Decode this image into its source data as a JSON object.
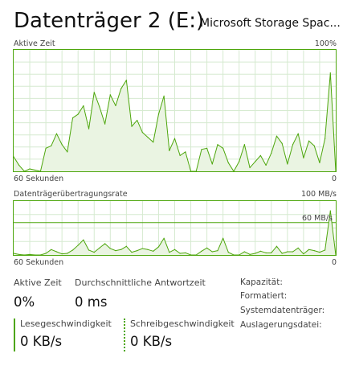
{
  "header": {
    "title": "Datenträger 2 (E:)",
    "model": "Microsoft Storage Spac..."
  },
  "active_time_graph": {
    "label": "Aktive Zeit",
    "max_label": "100%",
    "time_label": "60 Sekunden",
    "min_label": "0"
  },
  "transfer_graph": {
    "label": "Datenträgerübertragungsrate",
    "max_label": "100 MB/s",
    "ref_label": "60 MB/s",
    "time_label": "60 Sekunden",
    "min_label": "0"
  },
  "stats": {
    "active_time": {
      "label": "Aktive Zeit",
      "value": "0%"
    },
    "avg_response": {
      "label": "Durchschnittliche Antwortzeit",
      "value": "0 ms"
    },
    "read_speed": {
      "label": "Lesegeschwindigkeit",
      "value": "0 KB/s"
    },
    "write_speed": {
      "label": "Schreibgeschwindigkeit",
      "value": "0 KB/s"
    }
  },
  "properties": [
    {
      "label": "Kapazität:",
      "value": ""
    },
    {
      "label": "Formatiert:",
      "value": ""
    },
    {
      "label": "Systemdatenträger:",
      "value": ""
    },
    {
      "label": "Auslagerungsdatei:",
      "value": ""
    }
  ],
  "colors": {
    "line": "#4da60c",
    "fill": "#eaf4e2",
    "grid": "#d6ead0",
    "border": "#4da60c"
  },
  "chart_data": [
    {
      "type": "area",
      "ylabel": "Aktive Zeit",
      "x_unit": "seconds ago",
      "xlim": [
        60,
        0
      ],
      "ylim": [
        0,
        100
      ],
      "grid": true,
      "x": [
        60,
        59,
        58,
        57,
        56,
        55,
        54,
        53,
        52,
        51,
        50,
        49,
        48,
        47,
        46,
        45,
        44,
        43,
        42,
        41,
        40,
        39,
        38,
        37,
        36,
        35,
        34,
        33,
        32,
        31,
        30,
        29,
        28,
        27,
        26,
        25,
        24,
        23,
        22,
        21,
        20,
        19,
        18,
        17,
        16,
        15,
        14,
        13,
        12,
        11,
        10,
        9,
        8,
        7,
        6,
        5,
        4,
        3,
        2,
        1,
        0
      ],
      "values": [
        12,
        5,
        0,
        2,
        1,
        0,
        19,
        21,
        31,
        22,
        16,
        44,
        47,
        54,
        35,
        65,
        53,
        39,
        63,
        54,
        68,
        75,
        37,
        42,
        32,
        28,
        24,
        47,
        62,
        17,
        27,
        13,
        16,
        0,
        0,
        18,
        19,
        6,
        22,
        19,
        7,
        0,
        8,
        22,
        3,
        8,
        13,
        5,
        15,
        29,
        23,
        6,
        22,
        31,
        11,
        25,
        21,
        7,
        27,
        81,
        0
      ],
      "series": [
        {
          "name": "Aktive Zeit"
        }
      ]
    },
    {
      "type": "line",
      "ylabel": "Datenträgerübertragungsrate",
      "x_unit": "seconds ago",
      "xlim": [
        60,
        0
      ],
      "ylim": [
        0,
        100
      ],
      "y_unit": "MB/s",
      "reference_line": 60,
      "grid": true,
      "x": [
        60,
        59,
        58,
        57,
        56,
        55,
        54,
        53,
        52,
        51,
        50,
        49,
        48,
        47,
        46,
        45,
        44,
        43,
        42,
        41,
        40,
        39,
        38,
        37,
        36,
        35,
        34,
        33,
        32,
        31,
        30,
        29,
        28,
        27,
        26,
        25,
        24,
        23,
        22,
        21,
        20,
        19,
        18,
        17,
        16,
        15,
        14,
        13,
        12,
        11,
        10,
        9,
        8,
        7,
        6,
        5,
        4,
        3,
        2,
        1,
        0
      ],
      "values": [
        3,
        1,
        0,
        1,
        0,
        0,
        3,
        10,
        6,
        2,
        3,
        9,
        18,
        28,
        9,
        5,
        13,
        21,
        12,
        8,
        10,
        16,
        5,
        8,
        12,
        10,
        7,
        15,
        31,
        5,
        10,
        3,
        4,
        0,
        0,
        7,
        13,
        6,
        8,
        31,
        5,
        0,
        0,
        6,
        1,
        3,
        7,
        4,
        4,
        16,
        3,
        6,
        6,
        13,
        2,
        10,
        8,
        5,
        9,
        82,
        0
      ],
      "series": [
        {
          "name": "Datenträgerübertragungsrate"
        }
      ]
    }
  ]
}
